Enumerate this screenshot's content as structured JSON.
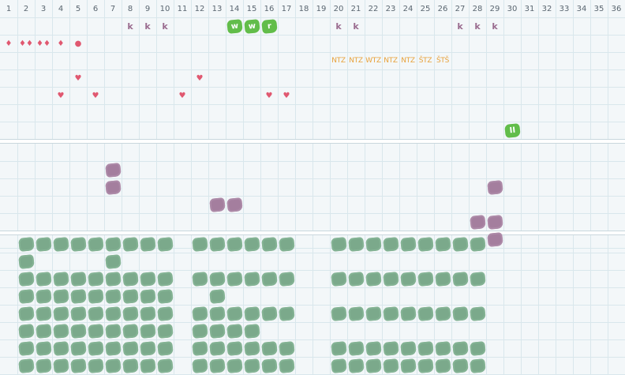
{
  "days": [
    "1",
    "2",
    "3",
    "4",
    "5",
    "6",
    "7",
    "8",
    "9",
    "10",
    "11",
    "12",
    "13",
    "14",
    "15",
    "16",
    "17",
    "18",
    "19",
    "20",
    "21",
    "22",
    "23",
    "24",
    "25",
    "26",
    "27",
    "28",
    "29",
    "30",
    "31",
    "32",
    "33",
    "34",
    "35",
    "36"
  ],
  "colors": {
    "grid": "#d9e7ec",
    "green": "#7ba98b",
    "lime": "#62bd4a",
    "purple": "#a47e9e",
    "pink": "#e05870",
    "orange": "#e8a13a",
    "k": "#9a6c8f"
  },
  "marks": [
    {
      "row": 1,
      "col": 8,
      "kind": "k",
      "text": "k"
    },
    {
      "row": 1,
      "col": 9,
      "kind": "k",
      "text": "k"
    },
    {
      "row": 1,
      "col": 10,
      "kind": "k",
      "text": "k"
    },
    {
      "row": 1,
      "col": 14,
      "kind": "lime",
      "text": "w"
    },
    {
      "row": 1,
      "col": 15,
      "kind": "lime",
      "text": "w"
    },
    {
      "row": 1,
      "col": 16,
      "kind": "lime",
      "text": "r"
    },
    {
      "row": 1,
      "col": 20,
      "kind": "k",
      "text": "k"
    },
    {
      "row": 1,
      "col": 21,
      "kind": "k",
      "text": "k"
    },
    {
      "row": 1,
      "col": 27,
      "kind": "k",
      "text": "k"
    },
    {
      "row": 1,
      "col": 28,
      "kind": "k",
      "text": "k"
    },
    {
      "row": 1,
      "col": 29,
      "kind": "k",
      "text": "k"
    },
    {
      "row": 2,
      "col": 1,
      "kind": "drop",
      "text": "♦"
    },
    {
      "row": 2,
      "col": 2,
      "kind": "drop",
      "text": "♦♦"
    },
    {
      "row": 2,
      "col": 3,
      "kind": "drop",
      "text": "♦♦"
    },
    {
      "row": 2,
      "col": 4,
      "kind": "drop",
      "text": "♦"
    },
    {
      "row": 2,
      "col": 5,
      "kind": "drop",
      "text": "●"
    },
    {
      "row": 3,
      "col": 20,
      "kind": "ntz",
      "text": "NTZ"
    },
    {
      "row": 3,
      "col": 21,
      "kind": "ntz",
      "text": "NTZ"
    },
    {
      "row": 3,
      "col": 22,
      "kind": "ntz",
      "text": "WTZ"
    },
    {
      "row": 3,
      "col": 23,
      "kind": "ntz",
      "text": "NTZ"
    },
    {
      "row": 3,
      "col": 24,
      "kind": "ntz",
      "text": "NTZ"
    },
    {
      "row": 3,
      "col": 25,
      "kind": "ntz",
      "text": "ŠTZ"
    },
    {
      "row": 3,
      "col": 26,
      "kind": "ntz",
      "text": "ŠTŠ"
    },
    {
      "row": 4,
      "col": 5,
      "kind": "heart",
      "text": "♥"
    },
    {
      "row": 4,
      "col": 12,
      "kind": "heart",
      "text": "♥"
    },
    {
      "row": 5,
      "col": 4,
      "kind": "heart",
      "text": "♥"
    },
    {
      "row": 5,
      "col": 6,
      "kind": "heart",
      "text": "♥"
    },
    {
      "row": 5,
      "col": 11,
      "kind": "heart",
      "text": "♥"
    },
    {
      "row": 5,
      "col": 16,
      "kind": "heart",
      "text": "♥"
    },
    {
      "row": 5,
      "col": 17,
      "kind": "heart",
      "text": "♥"
    },
    {
      "row": 7,
      "col": 30,
      "kind": "lime",
      "text": "II"
    }
  ],
  "purple_cells": [
    [
      9,
      7
    ],
    [
      10,
      7
    ],
    [
      10,
      29
    ],
    [
      11,
      13
    ],
    [
      11,
      14
    ],
    [
      12,
      28
    ],
    [
      12,
      29
    ],
    [
      13,
      29
    ]
  ],
  "green_rows": [
    {
      "row": 14,
      "cols": "2-10,12-17,20-28"
    },
    {
      "row": 15,
      "cols": "2,7"
    },
    {
      "row": 16,
      "cols": "2-10,12-17,20-28"
    },
    {
      "row": 17,
      "cols": "2-10,13"
    },
    {
      "row": 18,
      "cols": "2-10,12-17,20-28"
    },
    {
      "row": 19,
      "cols": "2-10,12-15"
    },
    {
      "row": 20,
      "cols": "2-10,12-17,20-28"
    },
    {
      "row": 21,
      "cols": "2-10,12-17,20-28"
    }
  ]
}
